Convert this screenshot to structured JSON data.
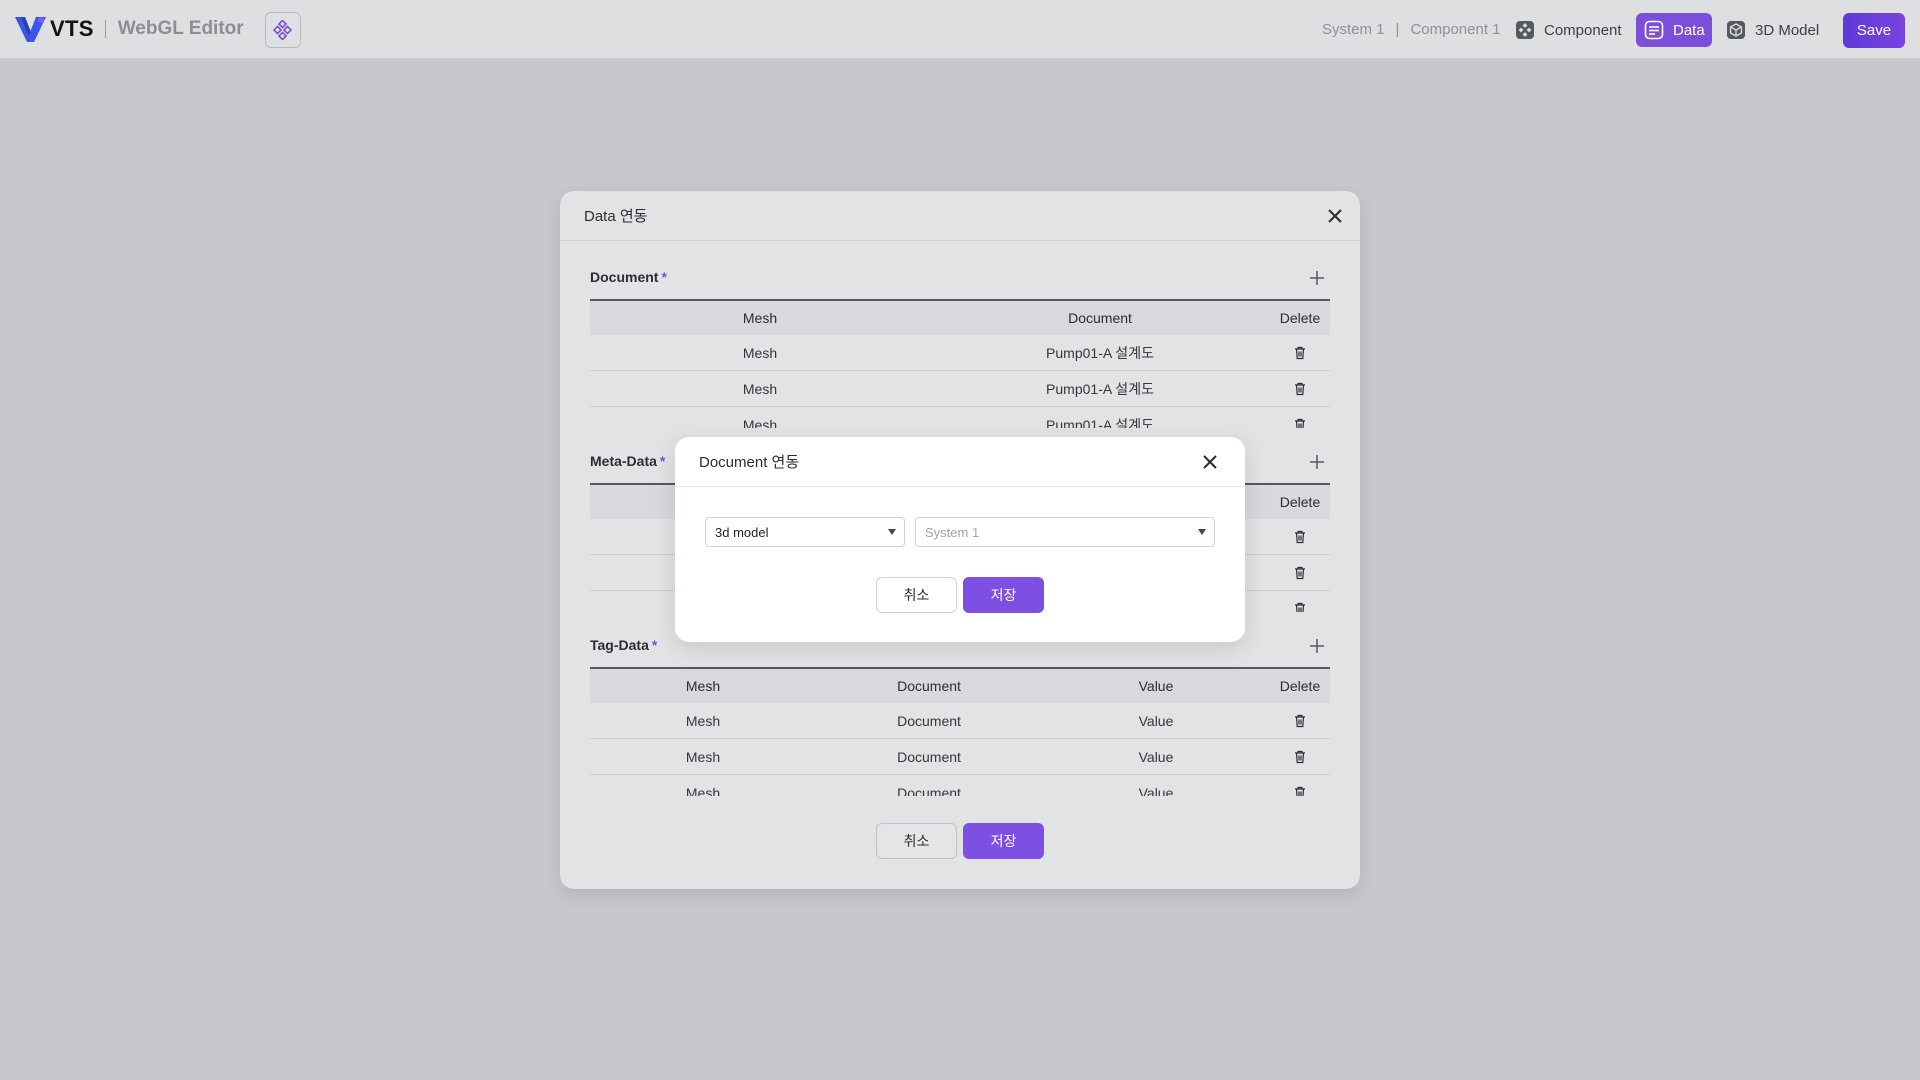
{
  "app": {
    "brand": "VTS",
    "subtitle": "WebGL Editor"
  },
  "breadcrumb": [
    "System 1",
    "Component 1"
  ],
  "breadcrumb_sep": "|",
  "nav": {
    "component_label": "Component",
    "data_label": "Data",
    "model_label": "3D Model",
    "active": "Data"
  },
  "toolbar": {
    "save_label": "Save"
  },
  "dialog": {
    "title": "Data 연동",
    "cancel_label": "취소",
    "save_label": "저장",
    "document": {
      "title": "Document",
      "required_mark": "*",
      "headers": [
        "Mesh",
        "Document",
        "Delete"
      ],
      "rows": [
        [
          "Mesh",
          "Pump01-A 설계도"
        ],
        [
          "Mesh",
          "Pump01-A 설계도"
        ],
        [
          "Mesh",
          "Pump01-A 설계도"
        ]
      ]
    },
    "meta": {
      "title": "Meta-Data",
      "required_mark": "*",
      "headers": [
        "Delete"
      ],
      "row_count": 3
    },
    "tag": {
      "title": "Tag-Data",
      "required_mark": "*",
      "headers": [
        "Mesh",
        "Document",
        "Value",
        "Delete"
      ],
      "rows": [
        [
          "Mesh",
          "Document",
          "Value"
        ],
        [
          "Mesh",
          "Document",
          "Value"
        ],
        [
          "Mesh",
          "Document",
          "Value"
        ]
      ]
    }
  },
  "modal": {
    "title": "Document 연동",
    "type_select_value": "3d model",
    "system_select_placeholder": "System 1",
    "cancel_label": "취소",
    "save_label": "저장"
  },
  "colors": {
    "accent": "#7d4fe3",
    "brand_blue": "#3b55e6",
    "background": "#c6c8cc"
  }
}
